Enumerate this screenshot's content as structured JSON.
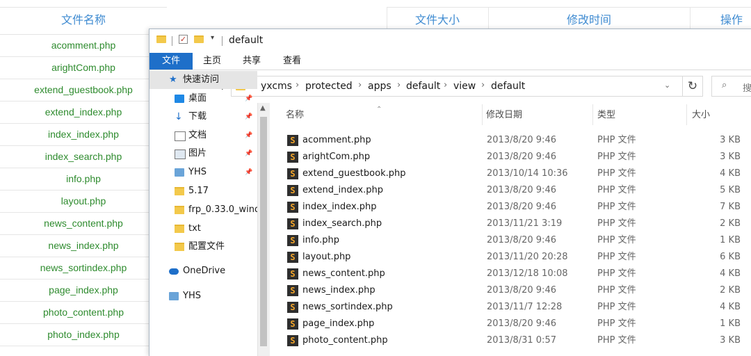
{
  "bg": {
    "headers": [
      "文件名称",
      "文件大小",
      "修改时间",
      "操作"
    ],
    "rows": [
      "acomment.php",
      "arightCom.php",
      "extend_guestbook.php",
      "extend_index.php",
      "index_index.php",
      "index_search.php",
      "info.php",
      "layout.php",
      "news_content.php",
      "news_index.php",
      "news_sortindex.php",
      "page_index.php",
      "photo_content.php",
      "photo_index.php"
    ]
  },
  "explorer": {
    "title": "default",
    "ribbon_tabs": [
      "文件",
      "主页",
      "共享",
      "查看"
    ],
    "path": [
      "yxcms",
      "protected",
      "apps",
      "default",
      "view",
      "default"
    ],
    "search_placeholder": "搜",
    "nav_items": [
      {
        "label": "快速访问",
        "icon": "star-icon"
      },
      {
        "label": "桌面",
        "icon": "desktop-icon"
      },
      {
        "label": "下载",
        "icon": "download-icon"
      },
      {
        "label": "文档",
        "icon": "document-icon"
      },
      {
        "label": "图片",
        "icon": "pictures-icon"
      },
      {
        "label": "YHS",
        "icon": "computer-icon"
      },
      {
        "label": "5.17",
        "icon": "folder-icon"
      },
      {
        "label": "frp_0.33.0_wind",
        "icon": "folder-icon"
      },
      {
        "label": "txt",
        "icon": "folder-icon"
      },
      {
        "label": "配置文件",
        "icon": "folder-icon"
      },
      {
        "label": "OneDrive",
        "icon": "cloud-icon"
      },
      {
        "label": "YHS",
        "icon": "computer-icon"
      }
    ],
    "columns": [
      "名称",
      "修改日期",
      "类型",
      "大小"
    ],
    "files": [
      {
        "name": "acomment.php",
        "date": "2013/8/20 9:46",
        "type": "PHP 文件",
        "size": "3 KB"
      },
      {
        "name": "arightCom.php",
        "date": "2013/8/20 9:46",
        "type": "PHP 文件",
        "size": "3 KB"
      },
      {
        "name": "extend_guestbook.php",
        "date": "2013/10/14 10:36",
        "type": "PHP 文件",
        "size": "4 KB"
      },
      {
        "name": "extend_index.php",
        "date": "2013/8/20 9:46",
        "type": "PHP 文件",
        "size": "5 KB"
      },
      {
        "name": "index_index.php",
        "date": "2013/8/20 9:46",
        "type": "PHP 文件",
        "size": "7 KB"
      },
      {
        "name": "index_search.php",
        "date": "2013/11/21 3:19",
        "type": "PHP 文件",
        "size": "2 KB"
      },
      {
        "name": "info.php",
        "date": "2013/8/20 9:46",
        "type": "PHP 文件",
        "size": "1 KB"
      },
      {
        "name": "layout.php",
        "date": "2013/11/20 20:28",
        "type": "PHP 文件",
        "size": "6 KB"
      },
      {
        "name": "news_content.php",
        "date": "2013/12/18 10:08",
        "type": "PHP 文件",
        "size": "4 KB"
      },
      {
        "name": "news_index.php",
        "date": "2013/8/20 9:46",
        "type": "PHP 文件",
        "size": "2 KB"
      },
      {
        "name": "news_sortindex.php",
        "date": "2013/11/7 12:28",
        "type": "PHP 文件",
        "size": "4 KB"
      },
      {
        "name": "page_index.php",
        "date": "2013/8/20 9:46",
        "type": "PHP 文件",
        "size": "1 KB"
      },
      {
        "name": "photo_content.php",
        "date": "2013/8/31 0:57",
        "type": "PHP 文件",
        "size": "3 KB"
      }
    ],
    "colors": {
      "accent": "#1e6fc9",
      "link_green": "#2e8b2e",
      "header_blue": "#3f8bd1"
    }
  }
}
